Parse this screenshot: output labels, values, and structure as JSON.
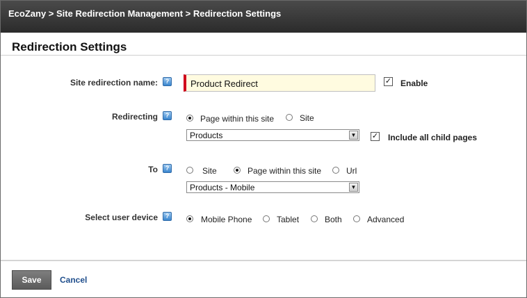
{
  "breadcrumb": "EcoZany > Site Redirection Management > Redirection Settings",
  "section_title": "Redirection Settings",
  "help_glyph": "?",
  "fields": {
    "name": {
      "label": "Site redirection name:",
      "value": "Product Redirect",
      "enable_label": "Enable",
      "enable_checked": true
    },
    "redirecting": {
      "label": "Redirecting",
      "options": [
        "Page within this site",
        "Site"
      ],
      "selected": "Page within this site",
      "dropdown_value": "Products",
      "include_children_label": "Include all child pages",
      "include_children_checked": true
    },
    "to": {
      "label": "To",
      "options": [
        "Site",
        "Page within this site",
        "Url"
      ],
      "selected": "Page within this site",
      "dropdown_value": "Products - Mobile"
    },
    "device": {
      "label": "Select user device",
      "options": [
        "Mobile Phone",
        "Tablet",
        "Both",
        "Advanced"
      ],
      "selected": "Mobile Phone"
    }
  },
  "actions": {
    "save_label": "Save",
    "cancel_label": "Cancel"
  },
  "colors": {
    "titlebar": "#2b2b2b",
    "required_marker": "#d0021b",
    "input_background": "#fffbe0",
    "link": "#1f4e8c",
    "save_button": "#6a6a6a"
  },
  "icons": {
    "help": "help-icon",
    "dropdown": "chevron-down-icon",
    "check": "checkmark-icon"
  }
}
